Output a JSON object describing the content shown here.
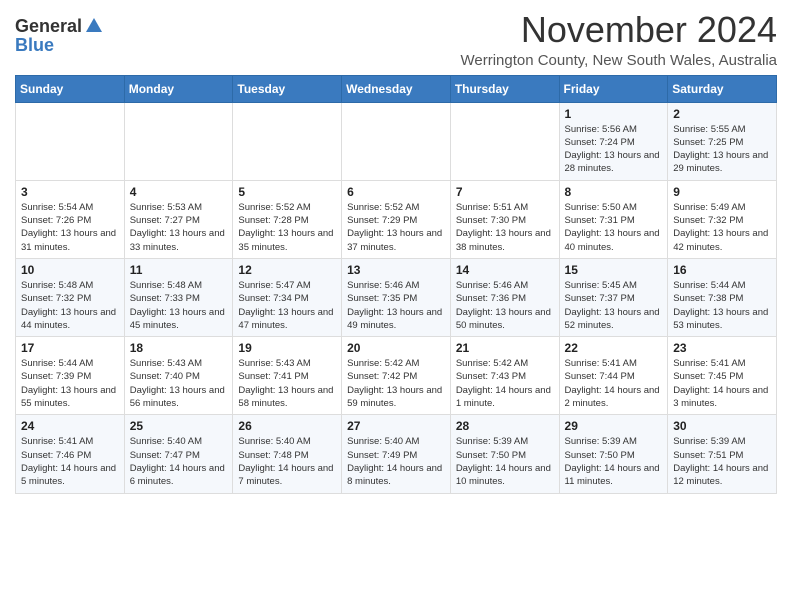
{
  "header": {
    "logo_general": "General",
    "logo_blue": "Blue",
    "month_title": "November 2024",
    "subtitle": "Werrington County, New South Wales, Australia"
  },
  "days_of_week": [
    "Sunday",
    "Monday",
    "Tuesday",
    "Wednesday",
    "Thursday",
    "Friday",
    "Saturday"
  ],
  "weeks": [
    [
      {
        "day": "",
        "info": ""
      },
      {
        "day": "",
        "info": ""
      },
      {
        "day": "",
        "info": ""
      },
      {
        "day": "",
        "info": ""
      },
      {
        "day": "",
        "info": ""
      },
      {
        "day": "1",
        "info": "Sunrise: 5:56 AM\nSunset: 7:24 PM\nDaylight: 13 hours and 28 minutes."
      },
      {
        "day": "2",
        "info": "Sunrise: 5:55 AM\nSunset: 7:25 PM\nDaylight: 13 hours and 29 minutes."
      }
    ],
    [
      {
        "day": "3",
        "info": "Sunrise: 5:54 AM\nSunset: 7:26 PM\nDaylight: 13 hours and 31 minutes."
      },
      {
        "day": "4",
        "info": "Sunrise: 5:53 AM\nSunset: 7:27 PM\nDaylight: 13 hours and 33 minutes."
      },
      {
        "day": "5",
        "info": "Sunrise: 5:52 AM\nSunset: 7:28 PM\nDaylight: 13 hours and 35 minutes."
      },
      {
        "day": "6",
        "info": "Sunrise: 5:52 AM\nSunset: 7:29 PM\nDaylight: 13 hours and 37 minutes."
      },
      {
        "day": "7",
        "info": "Sunrise: 5:51 AM\nSunset: 7:30 PM\nDaylight: 13 hours and 38 minutes."
      },
      {
        "day": "8",
        "info": "Sunrise: 5:50 AM\nSunset: 7:31 PM\nDaylight: 13 hours and 40 minutes."
      },
      {
        "day": "9",
        "info": "Sunrise: 5:49 AM\nSunset: 7:32 PM\nDaylight: 13 hours and 42 minutes."
      }
    ],
    [
      {
        "day": "10",
        "info": "Sunrise: 5:48 AM\nSunset: 7:32 PM\nDaylight: 13 hours and 44 minutes."
      },
      {
        "day": "11",
        "info": "Sunrise: 5:48 AM\nSunset: 7:33 PM\nDaylight: 13 hours and 45 minutes."
      },
      {
        "day": "12",
        "info": "Sunrise: 5:47 AM\nSunset: 7:34 PM\nDaylight: 13 hours and 47 minutes."
      },
      {
        "day": "13",
        "info": "Sunrise: 5:46 AM\nSunset: 7:35 PM\nDaylight: 13 hours and 49 minutes."
      },
      {
        "day": "14",
        "info": "Sunrise: 5:46 AM\nSunset: 7:36 PM\nDaylight: 13 hours and 50 minutes."
      },
      {
        "day": "15",
        "info": "Sunrise: 5:45 AM\nSunset: 7:37 PM\nDaylight: 13 hours and 52 minutes."
      },
      {
        "day": "16",
        "info": "Sunrise: 5:44 AM\nSunset: 7:38 PM\nDaylight: 13 hours and 53 minutes."
      }
    ],
    [
      {
        "day": "17",
        "info": "Sunrise: 5:44 AM\nSunset: 7:39 PM\nDaylight: 13 hours and 55 minutes."
      },
      {
        "day": "18",
        "info": "Sunrise: 5:43 AM\nSunset: 7:40 PM\nDaylight: 13 hours and 56 minutes."
      },
      {
        "day": "19",
        "info": "Sunrise: 5:43 AM\nSunset: 7:41 PM\nDaylight: 13 hours and 58 minutes."
      },
      {
        "day": "20",
        "info": "Sunrise: 5:42 AM\nSunset: 7:42 PM\nDaylight: 13 hours and 59 minutes."
      },
      {
        "day": "21",
        "info": "Sunrise: 5:42 AM\nSunset: 7:43 PM\nDaylight: 14 hours and 1 minute."
      },
      {
        "day": "22",
        "info": "Sunrise: 5:41 AM\nSunset: 7:44 PM\nDaylight: 14 hours and 2 minutes."
      },
      {
        "day": "23",
        "info": "Sunrise: 5:41 AM\nSunset: 7:45 PM\nDaylight: 14 hours and 3 minutes."
      }
    ],
    [
      {
        "day": "24",
        "info": "Sunrise: 5:41 AM\nSunset: 7:46 PM\nDaylight: 14 hours and 5 minutes."
      },
      {
        "day": "25",
        "info": "Sunrise: 5:40 AM\nSunset: 7:47 PM\nDaylight: 14 hours and 6 minutes."
      },
      {
        "day": "26",
        "info": "Sunrise: 5:40 AM\nSunset: 7:48 PM\nDaylight: 14 hours and 7 minutes."
      },
      {
        "day": "27",
        "info": "Sunrise: 5:40 AM\nSunset: 7:49 PM\nDaylight: 14 hours and 8 minutes."
      },
      {
        "day": "28",
        "info": "Sunrise: 5:39 AM\nSunset: 7:50 PM\nDaylight: 14 hours and 10 minutes."
      },
      {
        "day": "29",
        "info": "Sunrise: 5:39 AM\nSunset: 7:50 PM\nDaylight: 14 hours and 11 minutes."
      },
      {
        "day": "30",
        "info": "Sunrise: 5:39 AM\nSunset: 7:51 PM\nDaylight: 14 hours and 12 minutes."
      }
    ]
  ]
}
